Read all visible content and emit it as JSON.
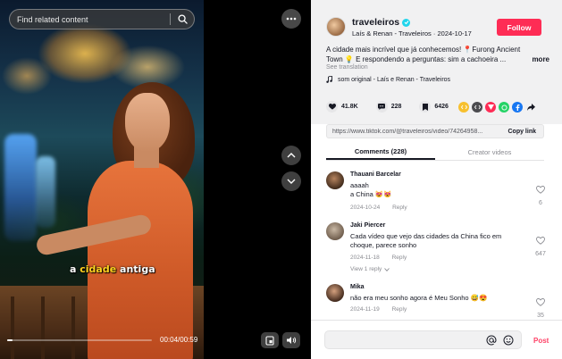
{
  "search": {
    "placeholder": "Find related content"
  },
  "video": {
    "caption_pre": "a ",
    "caption_highlight": "cidade",
    "caption_post": " antiga",
    "time": "00:04/00:59",
    "progress": 0.04
  },
  "author": {
    "username": "traveleiros",
    "display_name": "Laís & Renan - Traveleiros",
    "date": "2024-10-17",
    "follow_label": "Follow"
  },
  "description": {
    "line1": "A cidade mais incrível que já conhecemos! 📍Furong Ancient",
    "line2": "Town 💡 E respondendo a perguntas: sim a cachoeira ...",
    "more_label": "more",
    "translation_label": "See translation"
  },
  "sound": {
    "label": "som original - Laís e Renan - Traveleiros"
  },
  "stats": {
    "likes": "41.8K",
    "comments": "228",
    "saves": "6426"
  },
  "share_colors": [
    "#f7c02e",
    "#4b4b4f",
    "#fe2c55",
    "#25d366",
    "#1877f2"
  ],
  "link": {
    "url": "https://www.tiktok.com/@traveleiros/video/74264958...",
    "copy_label": "Copy link"
  },
  "tabs": [
    {
      "label": "Comments (228)",
      "active": true
    },
    {
      "label": "Creator videos",
      "active": false
    }
  ],
  "comments": [
    {
      "user": "Thauani Barcelar",
      "line1": "aaaah",
      "line2": "a China 😻😻",
      "date": "2024-10-24",
      "reply": "Reply",
      "likes": "6"
    },
    {
      "user": "Jaki Piercer",
      "line1": "Cada vídeo que vejo das cidades da China fico em",
      "line2": "choque, parece sonho",
      "date": "2024-11-18",
      "reply": "Reply",
      "likes": "647",
      "view_replies": "View 1 reply"
    },
    {
      "user": "Mika",
      "line1": "não era meu sonho agora é Meu Sonho 😅😍",
      "line2": "",
      "date": "2024-11-19",
      "reply": "Reply",
      "likes": "35"
    }
  ],
  "footer": {
    "post_label": "Post"
  }
}
